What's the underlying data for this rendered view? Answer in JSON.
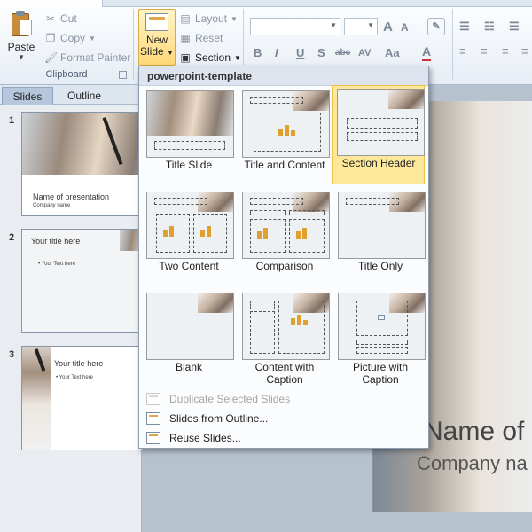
{
  "clipboard": {
    "paste_label": "Paste",
    "cut_label": "Cut",
    "copy_label": "Copy",
    "format_painter_label": "Format Painter",
    "group_label": "Clipboard"
  },
  "slides_group": {
    "new_slide_line1": "New",
    "new_slide_line2": "Slide",
    "layout_label": "Layout",
    "reset_label": "Reset",
    "section_label": "Section"
  },
  "font_group": {
    "bold": "B",
    "italic": "I",
    "underline": "U",
    "strike": "S",
    "shadow": "abc",
    "spacing": "AV",
    "case": "Aa",
    "grow": "A",
    "shrink": "A",
    "color": "A"
  },
  "pane": {
    "tabs": [
      "Slides",
      "Outline"
    ],
    "slides": [
      {
        "number": "1",
        "title": "Name of presentation",
        "subtitle": "Company  name"
      },
      {
        "number": "2",
        "title": "Your title here",
        "bullet": "• Your Text here"
      },
      {
        "number": "3",
        "title": "Your title here",
        "bullet": "• Your Text here"
      }
    ]
  },
  "main_slide": {
    "title": "Name of",
    "subtitle": "Company na"
  },
  "dropdown": {
    "header": "powerpoint-template",
    "layouts": [
      {
        "label": "Title Slide"
      },
      {
        "label": "Title and Content"
      },
      {
        "label": "Section Header",
        "selected": true
      },
      {
        "label": "Two Content"
      },
      {
        "label": "Comparison"
      },
      {
        "label": "Title Only"
      },
      {
        "label": "Blank"
      },
      {
        "label": "Content with Caption"
      },
      {
        "label": "Picture with Caption"
      }
    ],
    "menu": [
      {
        "label": "Duplicate Selected Slides",
        "enabled": false
      },
      {
        "label": "Slides from Outline...",
        "enabled": true
      },
      {
        "label": "Reuse Slides...",
        "enabled": true
      }
    ]
  },
  "colors": {
    "highlight": "#fde89a",
    "ribbon": "#e7edf5",
    "accent_orange": "#e0a030"
  }
}
